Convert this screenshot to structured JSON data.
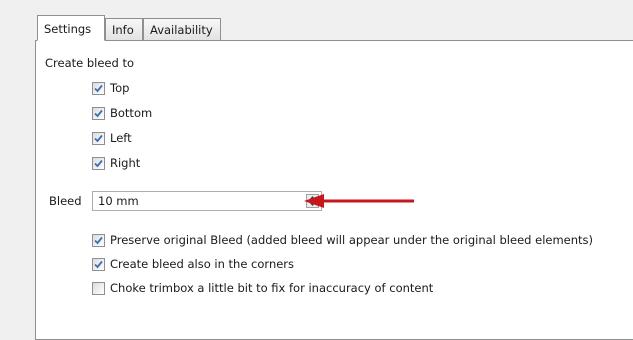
{
  "tabs": [
    {
      "label": "Settings",
      "active": true
    },
    {
      "label": "Info",
      "active": false
    },
    {
      "label": "Availability",
      "active": false
    }
  ],
  "create_bleed": {
    "label": "Create bleed to",
    "options": [
      {
        "label": "Top",
        "checked": true
      },
      {
        "label": "Bottom",
        "checked": true
      },
      {
        "label": "Left",
        "checked": true
      },
      {
        "label": "Right",
        "checked": true
      }
    ]
  },
  "bleed": {
    "label": "Bleed",
    "value": "10 mm"
  },
  "options": [
    {
      "label": "Preserve original Bleed (added bleed will appear under the original bleed elements)",
      "checked": true
    },
    {
      "label": "Create bleed also in the corners",
      "checked": true
    },
    {
      "label": "Choke trimbox a little bit to fix for inaccuracy of content",
      "checked": false
    }
  ],
  "colors": {
    "annotation_arrow": "#c8161d",
    "check": "#3a6fb5"
  }
}
